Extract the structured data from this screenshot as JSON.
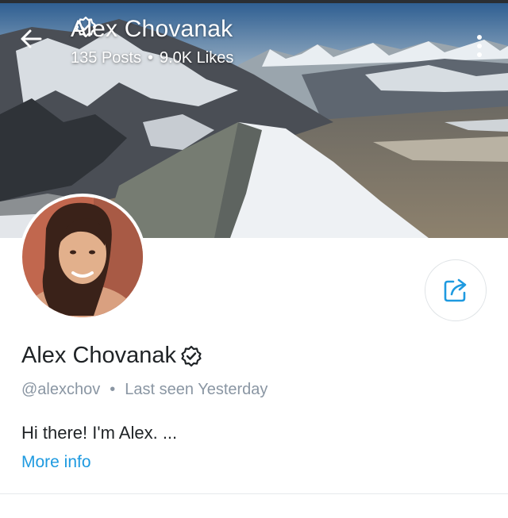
{
  "header": {
    "title": "Alex Chovanak",
    "posts": "135 Posts",
    "separator": "•",
    "likes": "9.0K Likes",
    "back_icon": "arrow-left-icon",
    "more_icon": "kebab-menu-icon"
  },
  "profile": {
    "name": "Alex Chovanak",
    "verified_icon": "verified-badge-icon",
    "handle": "@alexchov",
    "separator": "•",
    "last_seen": "Last seen Yesterday",
    "bio": "Hi there! I'm Alex. ...",
    "more_info": "More info",
    "share_icon": "share-icon"
  },
  "colors": {
    "accent": "#1e9ae0",
    "muted_text": "#8a96a3",
    "primary_text": "#1f2326"
  }
}
